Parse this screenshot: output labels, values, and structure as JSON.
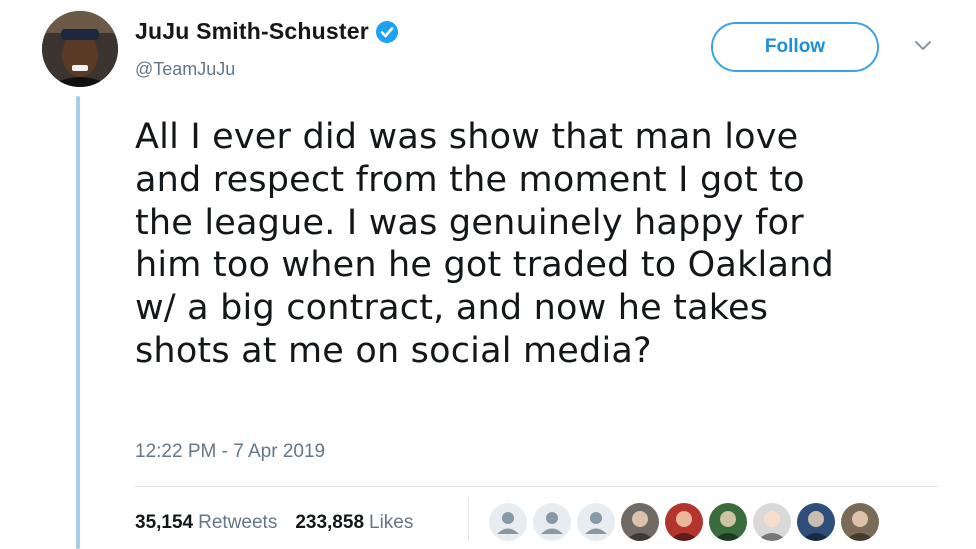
{
  "author": {
    "name": "JuJu Smith-Schuster",
    "handle": "@TeamJuJu",
    "verified": true
  },
  "follow_button": {
    "label": "Follow"
  },
  "tweet": {
    "lines": [
      "All I ever did was show that man love",
      "and respect from the moment I got to",
      "the league. I was genuinely happy for",
      "him too when he got traded to Oakland",
      "w/ a big contract, and now he takes",
      "shots at me on social media?"
    ],
    "timestamp": "12:22 PM - 7 Apr 2019"
  },
  "stats": {
    "retweets_count": "35,154",
    "retweets_label": "Retweets",
    "likes_count": "233,858",
    "likes_label": "Likes"
  },
  "colors": {
    "accent": "#1da1f2",
    "thread_line": "#a8cde9",
    "secondary_text": "#657786"
  },
  "likers": [
    {
      "icon": "default-avatar-icon",
      "bg": "#e6ecf0"
    },
    {
      "icon": "default-avatar-icon",
      "bg": "#e6ecf0"
    },
    {
      "icon": "default-avatar-icon",
      "bg": "#e6ecf0"
    },
    {
      "icon": "photo-avatar-icon",
      "bg": "#6f6a63"
    },
    {
      "icon": "photo-avatar-icon",
      "bg": "#b3342c"
    },
    {
      "icon": "photo-avatar-icon",
      "bg": "#3a6b3d"
    },
    {
      "icon": "photo-avatar-icon",
      "bg": "#d9d9d9"
    },
    {
      "icon": "photo-avatar-icon",
      "bg": "#2f4f7a"
    },
    {
      "icon": "photo-avatar-icon",
      "bg": "#7a6a58"
    }
  ]
}
